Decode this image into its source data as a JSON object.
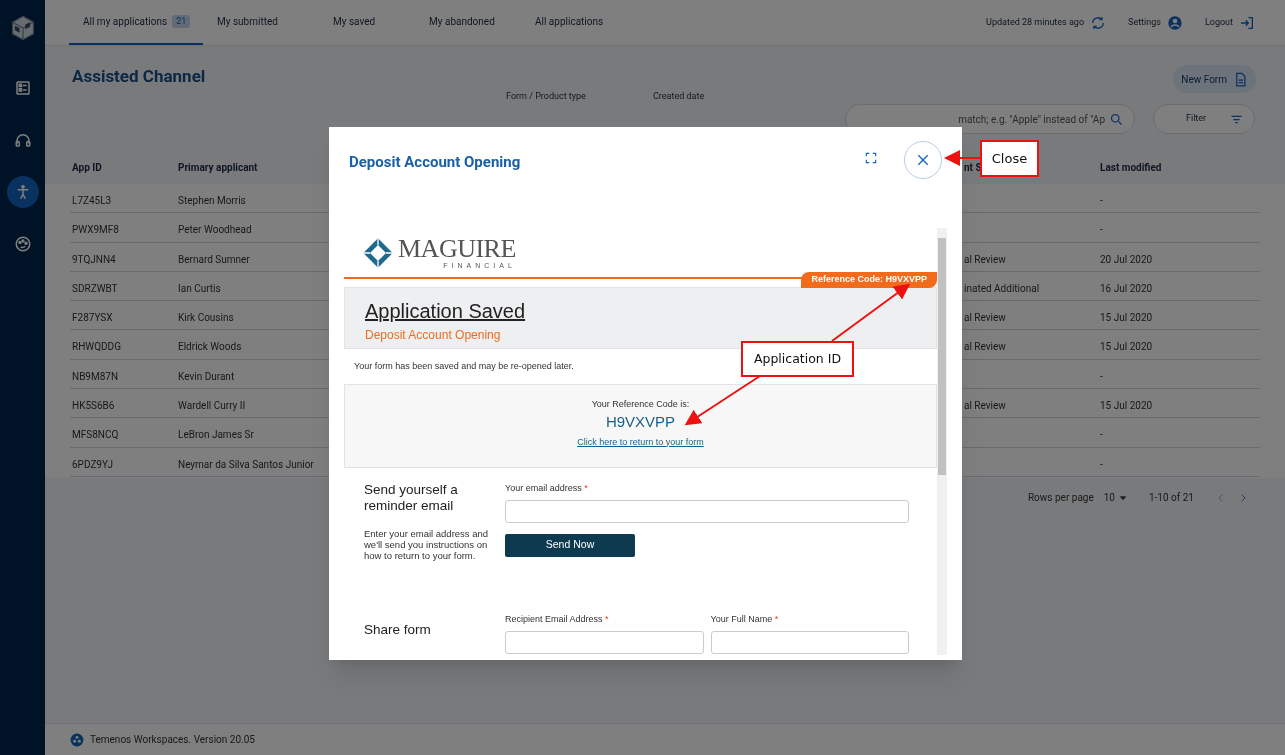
{
  "sidebar": {
    "items": [
      {
        "kind": "list",
        "selected": false
      },
      {
        "kind": "headset",
        "selected": false
      },
      {
        "kind": "accessibility",
        "selected": true
      },
      {
        "kind": "palette",
        "selected": false
      }
    ]
  },
  "tabs": [
    {
      "label": "All my applications",
      "count": "21",
      "selected": true
    },
    {
      "label": "My submitted",
      "selected": false
    },
    {
      "label": "My saved",
      "selected": false
    },
    {
      "label": "My abandoned",
      "selected": false
    },
    {
      "label": "All applications",
      "selected": false
    }
  ],
  "top_actions": [
    {
      "kind": "refresh",
      "label": "Updated 28 minutes ago"
    },
    {
      "kind": "settings",
      "label": "Settings"
    },
    {
      "kind": "logout",
      "label": "Logout"
    }
  ],
  "page_title": "Assisted Channel",
  "new_form_button": "New Form",
  "filters": {
    "product_label": "Form / Product type",
    "date_label": "Created date",
    "search_placeholder": "match; e.g. \"Apple\" instead of \"Ap",
    "filter_button": "Filter"
  },
  "table": {
    "columns": [
      "App ID",
      "Primary applicant",
      "nt S",
      "Last modified"
    ],
    "rows": [
      [
        "L7Z45L3",
        "Stephen Morris",
        "",
        "-"
      ],
      [
        "PWX9MF8",
        "Peter Woodhead",
        "",
        "-"
      ],
      [
        "9TQJNN4",
        "Bernard Sumner",
        "al Review",
        "20 Jul 2020"
      ],
      [
        "SDRZWBT",
        "Ian Curtis",
        "inated Additional",
        "16 Jul 2020"
      ],
      [
        "F287YSX",
        "Kirk Cousins",
        "al Review",
        "15 Jul 2020"
      ],
      [
        "RHWQDDG",
        "Eldrick Woods",
        "al Review",
        "15 Jul 2020"
      ],
      [
        "NB9M87N",
        "Kevin Durant",
        "",
        "-"
      ],
      [
        "HK5S6B6",
        "Wardell Curry II",
        "al Review",
        "15 Jul 2020"
      ],
      [
        "MFS8NCQ",
        "LeBron James Sr",
        "",
        "-"
      ],
      [
        "6PDZ9YJ",
        "Neymar da Silva Santos Junior",
        "",
        "-"
      ]
    ]
  },
  "pagination": {
    "rows_per_page_label": "Rows per page",
    "rows_per_page": "10",
    "range": "1-10 of 21"
  },
  "footer": "Temenos Workspaces. Version 20.05",
  "modal": {
    "title": "Deposit Account Opening",
    "logo": {
      "name": "MAGUIRE",
      "sub": "FINANCIAL"
    },
    "reference_badge": "Reference Code: H9VXVPP",
    "banner_title": "Application Saved",
    "banner_subtitle": "Deposit Account Opening",
    "saved_message": "Your form has been saved and may be re-opened later.",
    "reference_label": "Your Reference Code is:",
    "reference_code": "H9VXVPP",
    "return_link": "Click here to return to your form",
    "reminder": {
      "heading": "Send yourself a reminder email",
      "description": "Enter your email address and we'll send you instructions on how to return to your form.",
      "email_label": "Your email address",
      "email_required": "*",
      "button": "Send Now"
    },
    "share": {
      "heading": "Share form",
      "fields": [
        {
          "label": "Recipient Email Address",
          "required": "*"
        },
        {
          "label": "Your Full Name",
          "required": "*"
        }
      ]
    }
  },
  "annotations": [
    {
      "label": "Close"
    },
    {
      "label": "Application ID"
    }
  ]
}
